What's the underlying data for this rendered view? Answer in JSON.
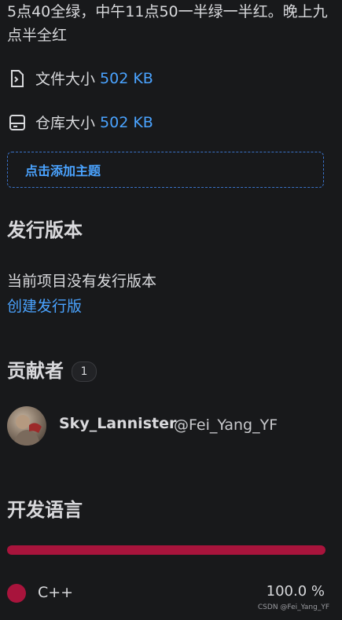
{
  "description": "5点40全绿，中午11点50一半绿一半红。晚上九点半全红",
  "meta": {
    "file_size_label": "文件大小",
    "file_size_value": "502 KB",
    "repo_size_label": "仓库大小",
    "repo_size_value": "502 KB"
  },
  "topic_button_label": "点击添加主题",
  "releases": {
    "heading": "发行版本",
    "empty_text": "当前项目没有发行版本",
    "create_link": "创建发行版"
  },
  "contributors": {
    "heading": "贡献者",
    "count": "1",
    "items": [
      {
        "name": "Sky_Lannister",
        "handle": "@Fei_Yang_YF"
      }
    ]
  },
  "languages": {
    "heading": "开发语言",
    "items": [
      {
        "name": "C++",
        "percent": "100.0 %",
        "color": "#a8143c"
      }
    ]
  },
  "watermark": "CSDN @Fei_Yang_YF"
}
